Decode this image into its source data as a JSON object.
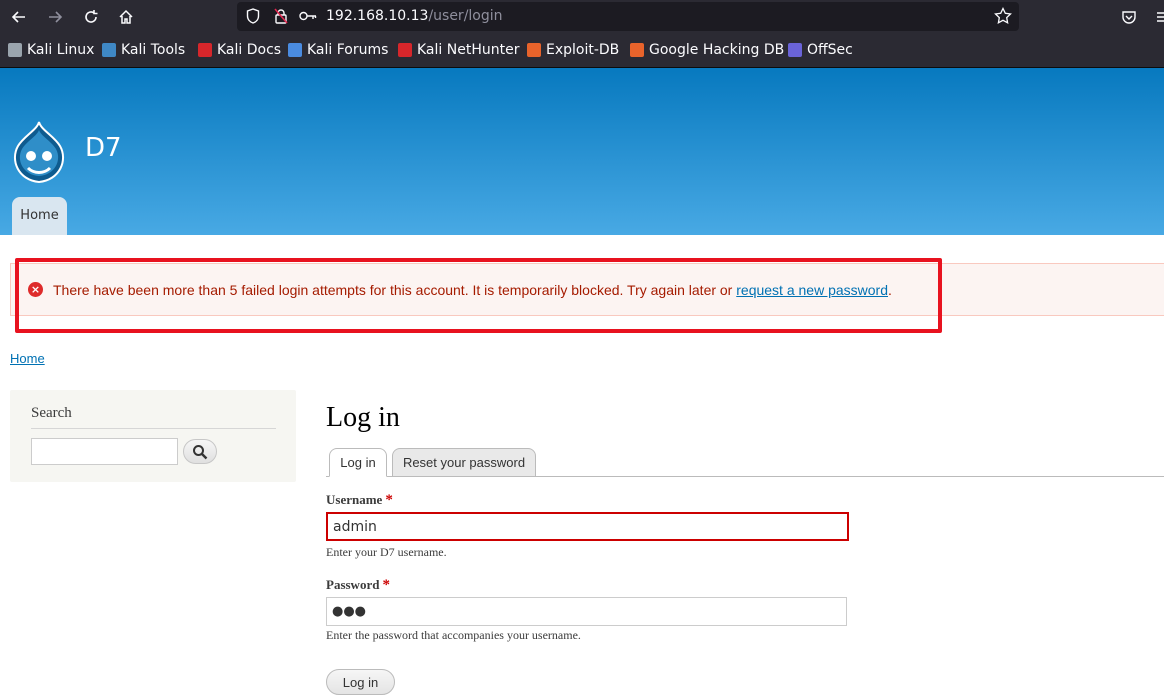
{
  "browser": {
    "url_host": "192.168.10.13",
    "url_path": "/user/login",
    "nav_icons": [
      "back-icon",
      "forward-icon",
      "reload-icon",
      "home-icon"
    ],
    "url_icons": [
      "shield-icon",
      "insecure-lock-icon",
      "key-icon"
    ],
    "right_icons": [
      "star-icon",
      "pocket-icon",
      "menu-icon"
    ]
  },
  "bookmarks": [
    {
      "label": "Kali Linux",
      "color": "#9aa4ad"
    },
    {
      "label": "Kali Tools",
      "color": "#3f88c5"
    },
    {
      "label": "Kali Docs",
      "color": "#d7262b"
    },
    {
      "label": "Kali Forums",
      "color": "#4a8be0"
    },
    {
      "label": "Kali NetHunter",
      "color": "#d7262b"
    },
    {
      "label": "Exploit-DB",
      "color": "#e8632b"
    },
    {
      "label": "Google Hacking DB",
      "color": "#e8632b"
    },
    {
      "label": "OffSec",
      "color": "#6a63d8"
    }
  ],
  "site": {
    "name": "D7",
    "nav_home": "Home"
  },
  "error": {
    "text": "There have been more than 5 failed login attempts for this account. It is temporarily blocked. Try again later or ",
    "link": "request a new password",
    "suffix": ".",
    "icon": "error-x-icon"
  },
  "breadcrumb": "Home",
  "sidebar": {
    "title": "Search",
    "search_value": "",
    "search_icon": "magnifier-icon"
  },
  "main": {
    "title": "Log in",
    "tabs": [
      {
        "label": "Log in",
        "active": true
      },
      {
        "label": "Reset your password",
        "active": false
      }
    ],
    "username_label": "Username",
    "username_value": "admin",
    "username_desc": "Enter your D7 username.",
    "password_label": "Password",
    "password_value": "●●●",
    "password_desc": "Enter the password that accompanies your username.",
    "required_mark": "*",
    "submit": "Log in"
  },
  "colors": {
    "header_top": "#0779bf",
    "header_bottom": "#48a9e4",
    "error_text": "#a51b00",
    "highlight_outline": "#e8121f",
    "link": "#0071b3"
  }
}
